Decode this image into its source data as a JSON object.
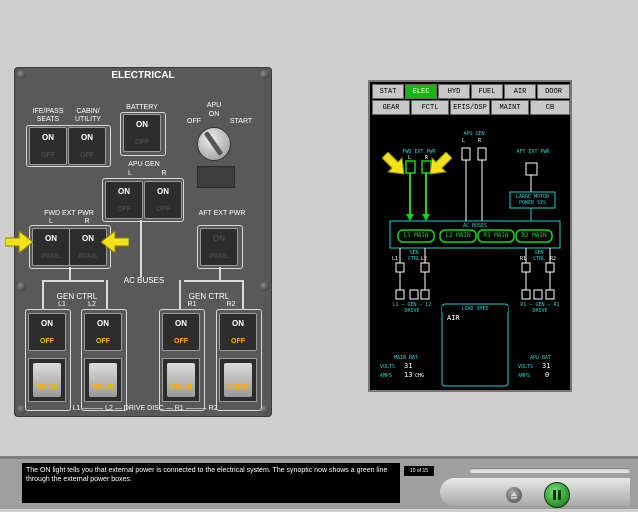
{
  "panel": {
    "title": "ELECTRICAL",
    "ife_label": "IFE/PASS\nSEATS",
    "cabin_label": "CABIN/\nUTILITY",
    "battery_label": "BATTERY",
    "apu_label": "APU",
    "apu_off": "OFF",
    "apu_on": "ON",
    "apu_start": "START",
    "apu_gen_label": "APU GEN",
    "apu_gen_l": "L",
    "apu_gen_r": "R",
    "fwd_ext_pwr_label": "FWD EXT PWR",
    "fwd_l": "L",
    "fwd_r": "R",
    "aft_ext_pwr_label": "AFT EXT PWR",
    "ac_buses_label": "AC BUSES",
    "gen_ctrl_left": "GEN CTRL",
    "gen_ctrl_right": "GEN CTRL",
    "l1": "L1",
    "l2": "L2",
    "r1": "R1",
    "r2": "R2",
    "on": "ON",
    "off": "OFF",
    "avail": "AVAIL",
    "drive": "DRIVE",
    "drive_disc": "L1 ——— L2 — DRIVE DISC — R1 ——— R2"
  },
  "eicas": {
    "tabs_row1": [
      "STAT",
      "ELEC",
      "HYD",
      "FUEL",
      "AIR",
      "DOOR"
    ],
    "tabs_row2": [
      "GEAR",
      "FCTL",
      "EFIS/DSP",
      "MAINT",
      "CB"
    ],
    "active_tab": "ELEC",
    "apu_gen": "APU GEN",
    "apu_gen_l": "L",
    "apu_gen_r": "R",
    "fwd_ext_pwr": "FWD EXT PWR",
    "fwd_l": "L",
    "fwd_r": "R",
    "aft_ext_pwr": "AFT EXT PWR",
    "large_motor": "LARGE MOTOR\nPOWER SYS",
    "ac_buses": "AC BUSES",
    "buses": [
      "L1 MAIN",
      "L2 MAIN",
      "R1 MAIN",
      "R2 MAIN"
    ],
    "l1": "L1",
    "l2": "L2",
    "r1": "R1",
    "r2": "R2",
    "gen_ctrl": "GEN\nCTRL",
    "left_drive": "L1 — GEN — L2\nDRIVE",
    "right_drive": "R1 — GEN — R2\nDRIVE",
    "load_shed": "LOAD SHED",
    "air": "AIR",
    "main_bat": "MAIN BAT",
    "main_volts_label": "VOLTS",
    "main_volts": "31",
    "main_amps_label": "AMPS",
    "main_amps": "13",
    "main_amps_unit": "CHG",
    "apu_bat": "APU BAT",
    "apu_volts_label": "VOLTS",
    "apu_volts": "31",
    "apu_amps_label": "AMPS",
    "apu_amps": "0"
  },
  "bottom": {
    "message": "The ON light tells you that external power is connected to the electrical system. The synoptic now shows a green line through the external power boxes.",
    "pager": "10 of 15"
  },
  "colors": {
    "green": "#14d814",
    "cyan": "#20d0d0",
    "amber": "#ffb000",
    "yellow_arrow": "#f2e21a"
  }
}
